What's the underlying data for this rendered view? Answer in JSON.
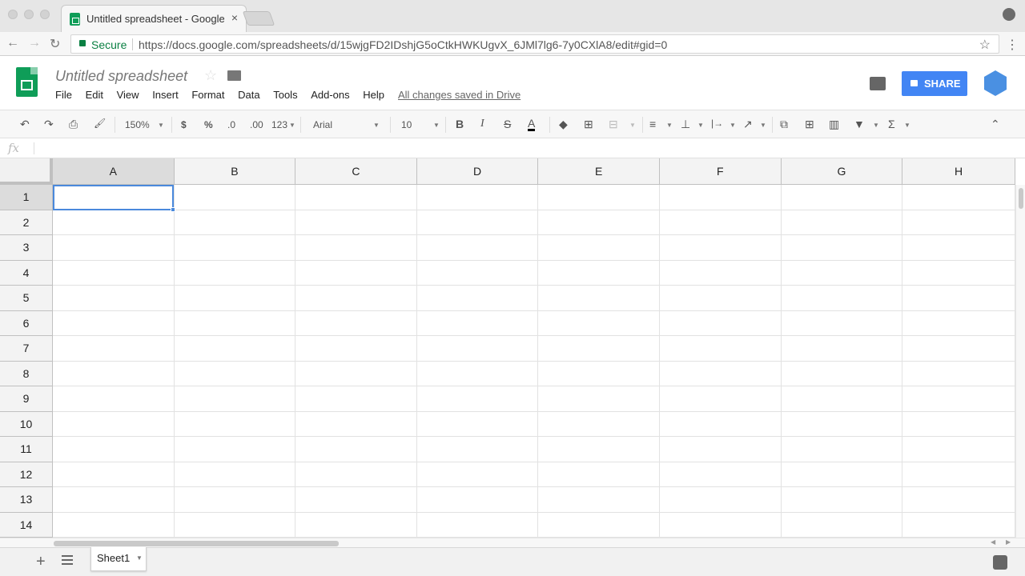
{
  "browser": {
    "tab_title": "Untitled spreadsheet - Google",
    "tab_close": "×",
    "secure_label": "Secure",
    "url": "https://docs.google.com/spreadsheets/d/15wjgFD2IDshjG5oCtkHWKUgvX_6JMl7lg6-7y0CXlA8/edit#gid=0",
    "back": "←",
    "forward": "→",
    "reload": "↻",
    "bookmark_star": "☆",
    "menu_dots": "⋮"
  },
  "header": {
    "title": "Untitled spreadsheet",
    "star": "☆",
    "menu": [
      "File",
      "Edit",
      "View",
      "Insert",
      "Format",
      "Data",
      "Tools",
      "Add-ons",
      "Help"
    ],
    "save_status": "All changes saved in Drive",
    "share_label": "SHARE"
  },
  "toolbar": {
    "undo": "↶",
    "redo": "↷",
    "print": "⎙",
    "paint_format": "🖌",
    "zoom": "150%",
    "currency": "$",
    "percent": "%",
    "decrease_decimal": ".0",
    "increase_decimal": ".00",
    "more_formats": "123",
    "font": "Arial",
    "font_size": "10",
    "bold": "B",
    "italic": "I",
    "strikethrough": "S",
    "text_color": "A",
    "fill_color": "◆",
    "borders": "⊞",
    "merge": "⊟",
    "h_align": "≡",
    "v_align": "⊥",
    "wrap": "|→",
    "rotate": "↗",
    "link": "⧉",
    "comment": "⊞",
    "chart": "▥",
    "filter": "▼",
    "functions": "Σ",
    "collapse": "⌃"
  },
  "formula_bar": {
    "fx_label": "fx",
    "value": ""
  },
  "grid": {
    "columns": [
      "A",
      "B",
      "C",
      "D",
      "E",
      "F",
      "G",
      "H"
    ],
    "rows": [
      "1",
      "2",
      "3",
      "4",
      "5",
      "6",
      "7",
      "8",
      "9",
      "10",
      "11",
      "12",
      "13",
      "14"
    ],
    "active_cell": "A1"
  },
  "sheets": {
    "add": "+",
    "tabs": [
      "Sheet1"
    ]
  },
  "colors": {
    "brand_green": "#0f9d58",
    "share_blue": "#4285f4",
    "selection_blue": "#4a89dc"
  }
}
